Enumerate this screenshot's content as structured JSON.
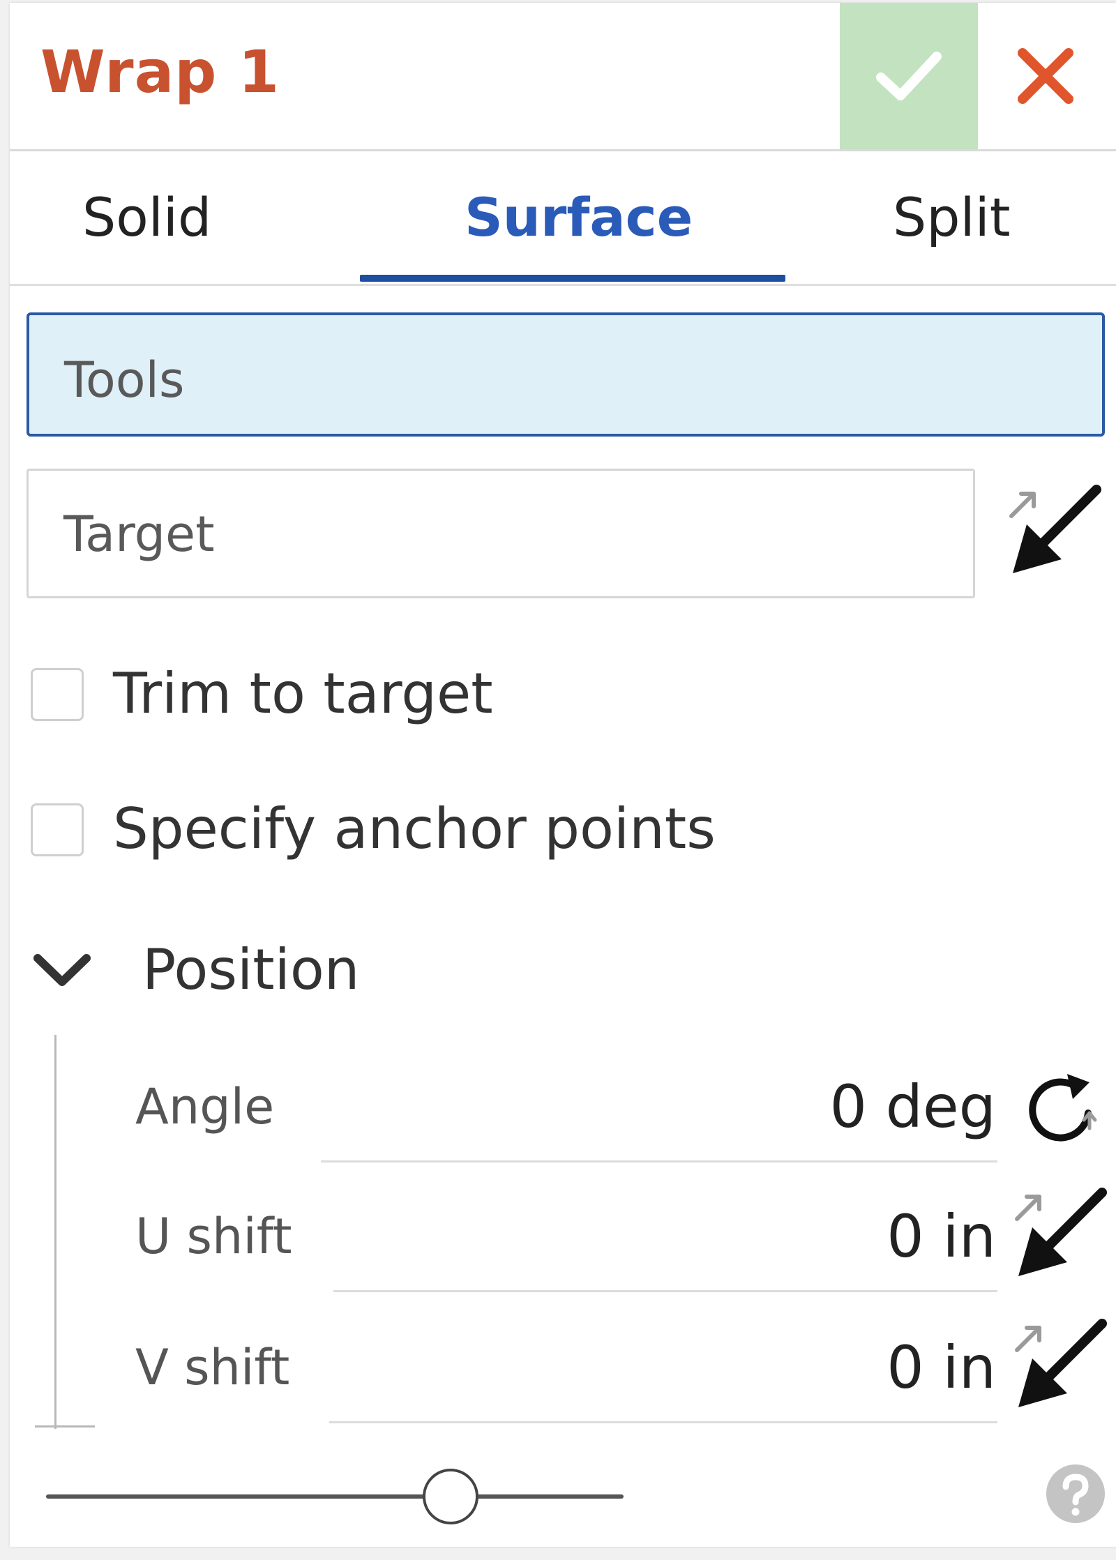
{
  "dialog": {
    "title": "Wrap 1",
    "ok_icon": "checkmark-icon",
    "close_icon": "close-x-icon"
  },
  "tabs": [
    {
      "label": "Solid",
      "active": false
    },
    {
      "label": "Surface",
      "active": true
    },
    {
      "label": "Split",
      "active": false
    }
  ],
  "fields": {
    "tools": {
      "label": "Tools",
      "active": true
    },
    "target": {
      "label": "Target",
      "icon": "flip-direction-arrow-icon"
    }
  },
  "options": {
    "trim_to_target": {
      "label": "Trim to target",
      "checked": false
    },
    "specify_anchor_points": {
      "label": "Specify anchor points",
      "checked": false
    }
  },
  "position": {
    "label": "Position",
    "expanded": true,
    "params": [
      {
        "label": "Angle",
        "value": "0 deg",
        "icon": "rotate-icon"
      },
      {
        "label": "U shift",
        "value": "0 in",
        "icon": "flip-direction-arrow-icon"
      },
      {
        "label": "V shift",
        "value": "0 in",
        "icon": "flip-direction-arrow-icon"
      }
    ]
  },
  "footer": {
    "slider_value_fraction": 0.7,
    "help_icon": "help-icon"
  },
  "colors": {
    "title": "#c8522f",
    "active_tab": "#2a5bb8",
    "ok_bg": "#c3e2c0",
    "close": "#e0552b",
    "tools_bg": "#dff0f8",
    "tools_border": "#2b5aa3"
  }
}
